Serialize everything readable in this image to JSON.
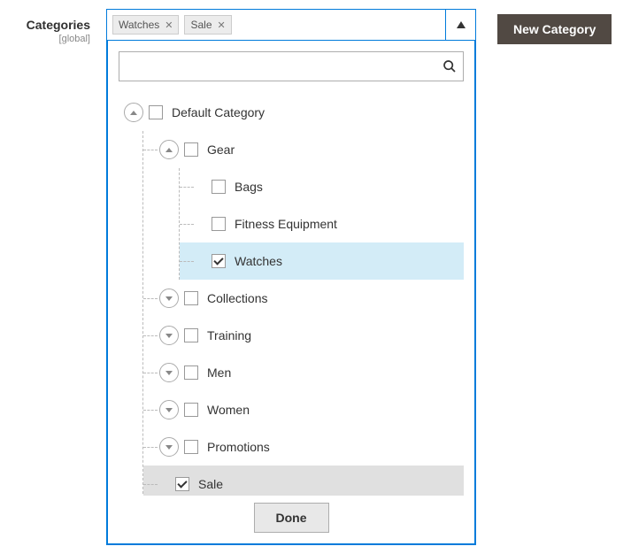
{
  "field": {
    "label": "Categories",
    "scope": "[global]"
  },
  "chips": [
    {
      "label": "Watches"
    },
    {
      "label": "Sale"
    }
  ],
  "buttons": {
    "new_category": "New Category",
    "done": "Done"
  },
  "search": {
    "placeholder": ""
  },
  "tree": {
    "root": {
      "label": "Default Category",
      "checked": false,
      "open": true
    },
    "gear": {
      "label": "Gear",
      "checked": false,
      "open": true
    },
    "bags": {
      "label": "Bags",
      "checked": false
    },
    "fitness": {
      "label": "Fitness Equipment",
      "checked": false
    },
    "watches": {
      "label": "Watches",
      "checked": true,
      "highlight": "blue"
    },
    "collections": {
      "label": "Collections",
      "checked": false,
      "open": false
    },
    "training": {
      "label": "Training",
      "checked": false,
      "open": false
    },
    "men": {
      "label": "Men",
      "checked": false,
      "open": false
    },
    "women": {
      "label": "Women",
      "checked": false,
      "open": false
    },
    "promotions": {
      "label": "Promotions",
      "checked": false,
      "open": false
    },
    "sale": {
      "label": "Sale",
      "checked": true,
      "highlight": "gray"
    }
  }
}
